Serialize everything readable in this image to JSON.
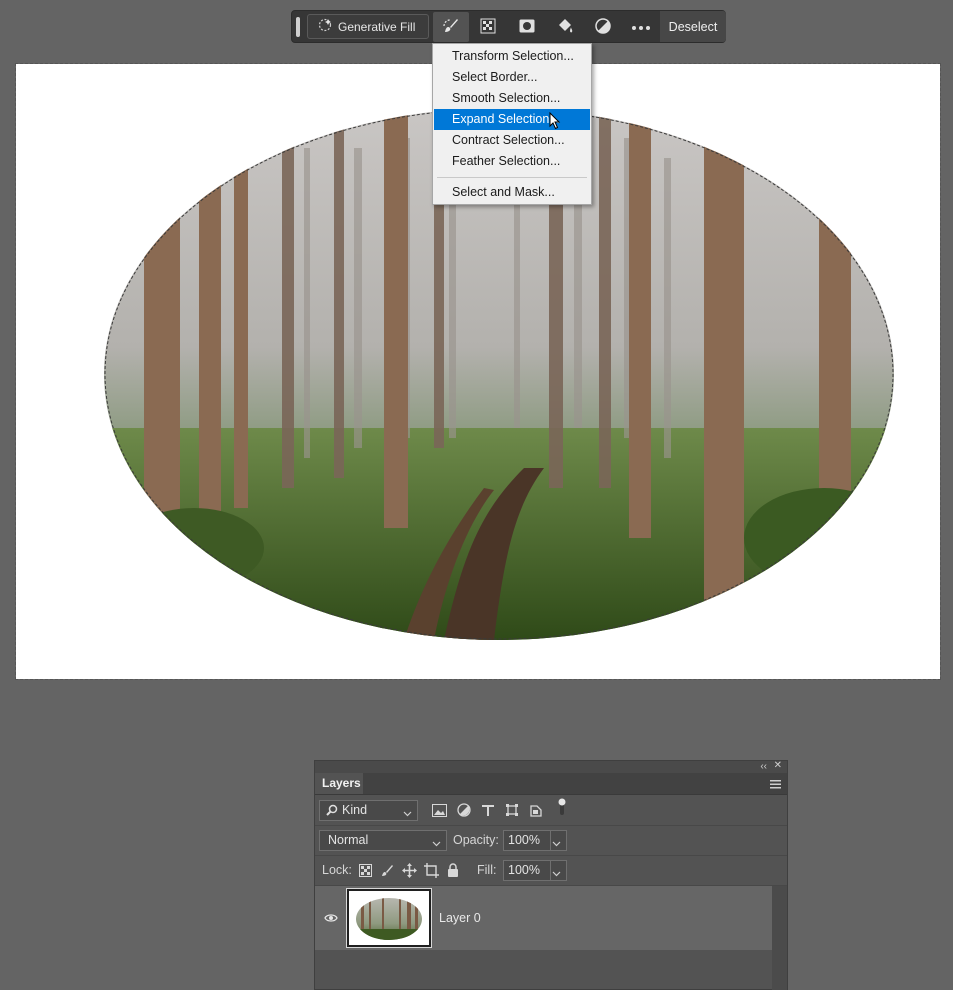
{
  "taskbar": {
    "generative_fill_label": "Generative Fill",
    "tools": [
      "brush-selection-icon",
      "checker-mask-icon",
      "mask-icon",
      "fill-bucket-icon",
      "adjustment-icon",
      "more-icon"
    ],
    "deselect_label": "Deselect"
  },
  "menu": {
    "items": [
      "Transform Selection...",
      "Select Border...",
      "Smooth Selection...",
      "Expand Selection...",
      "Contract Selection...",
      "Feather Selection..."
    ],
    "last_item": "Select and Mask...",
    "highlighted": "Expand Selection...",
    "highlight_color": "#0078d7"
  },
  "layers_panel": {
    "tab_label": "Layers",
    "filter_kind": "Kind",
    "blend_mode": "Normal",
    "opacity_label": "Opacity:",
    "opacity_value": "100%",
    "lock_label": "Lock:",
    "fill_label": "Fill:",
    "fill_value": "100%",
    "layers": [
      {
        "name": "Layer 0",
        "visible": true
      }
    ]
  },
  "colors": {
    "workspace": "#646464",
    "panel": "#535353",
    "selected_layer": "#666666",
    "taskbar": "#363636"
  }
}
